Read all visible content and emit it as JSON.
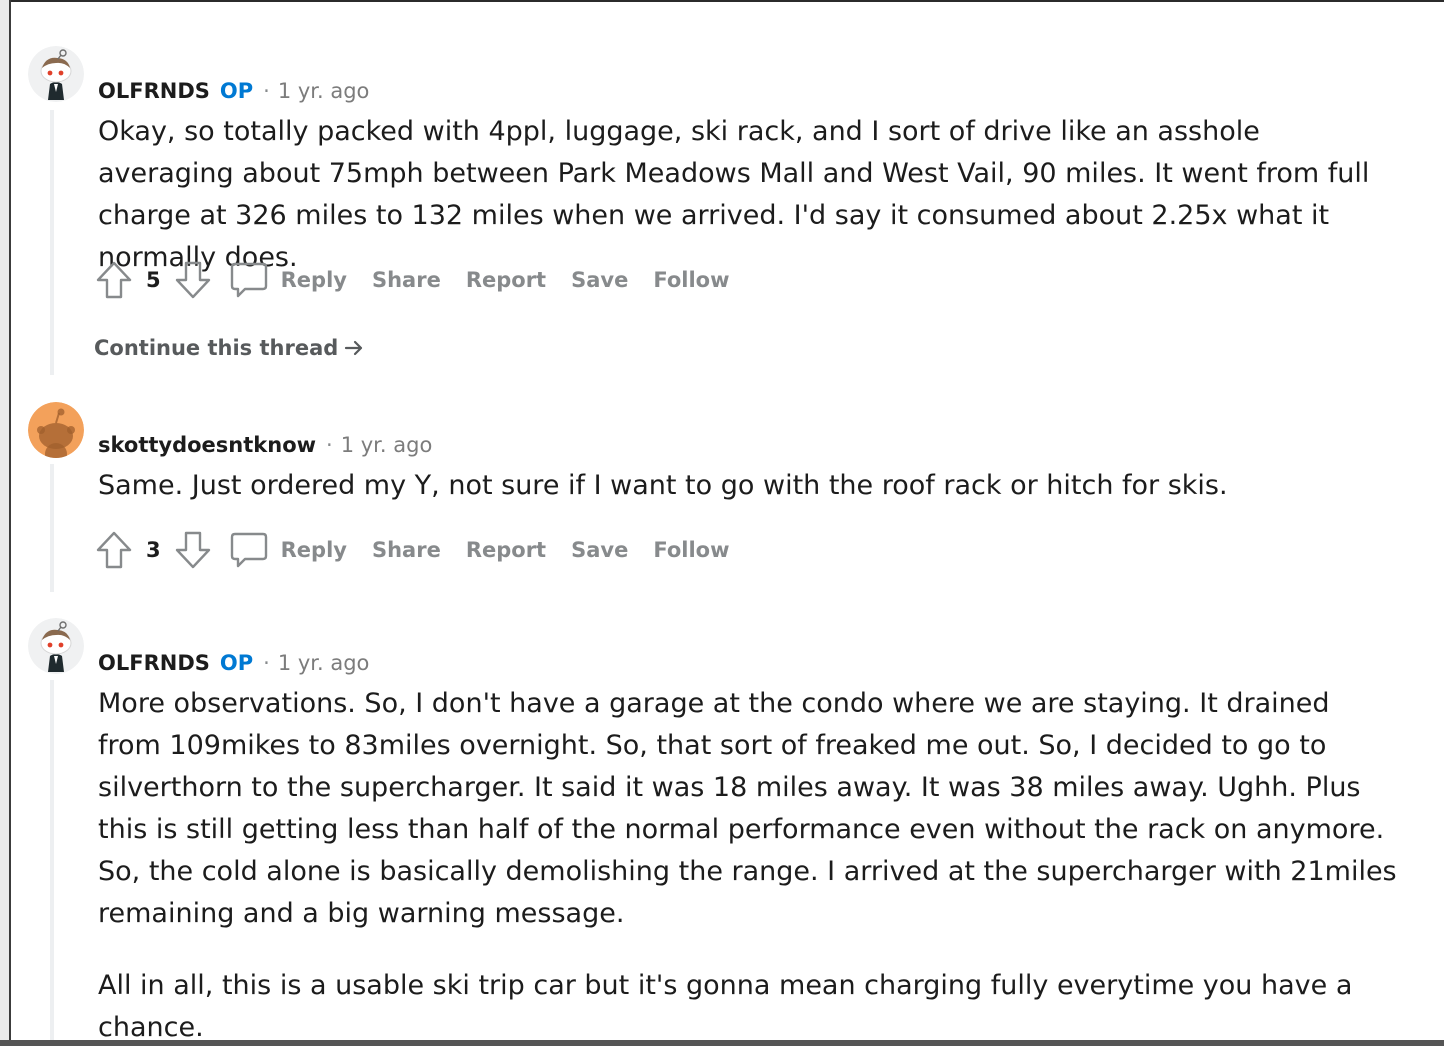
{
  "comments": [
    {
      "author": "OLFRNDS",
      "badge": "OP",
      "separator": "·",
      "time": "1 yr. ago",
      "avatar_icon": "snoo-avatar-costume-icon",
      "paragraphs": [
        "Okay, so totally packed with 4ppl, luggage, ski rack, and I sort of drive like an asshole averaging about 75mph between Park Meadows Mall and West Vail, 90 miles. It went from full charge at 326 miles to 132 miles when we arrived. I'd say it consumed about 2.25x what it normally does."
      ],
      "score": "5",
      "actions": {
        "reply": "Reply",
        "share": "Share",
        "report": "Report",
        "save": "Save",
        "follow": "Follow"
      },
      "continue_label": "Continue this thread"
    },
    {
      "author": "skottydoesntknow",
      "separator": "·",
      "time": "1 yr. ago",
      "avatar_icon": "snoo-avatar-default-icon",
      "paragraphs": [
        "Same. Just ordered my Y, not sure if I want to go with the roof rack or hitch for skis."
      ],
      "score": "3",
      "actions": {
        "reply": "Reply",
        "share": "Share",
        "report": "Report",
        "save": "Save",
        "follow": "Follow"
      }
    },
    {
      "author": "OLFRNDS",
      "badge": "OP",
      "separator": "·",
      "time": "1 yr. ago",
      "avatar_icon": "snoo-avatar-costume-icon",
      "paragraphs": [
        "More observations. So, I don't have a garage at the condo where we are staying. It drained from 109mikes to 83miles overnight. So, that sort of freaked me out. So, I decided to go to silverthorn to the supercharger. It said it was 18 miles away. It was 38 miles away. Ughh. Plus this is still getting less than half of the normal performance even without the rack on anymore. So, the cold alone is basically demolishing the range. I arrived at the supercharger with 21miles remaining and a big warning message.",
        "All in all, this is a usable ski trip car but it's gonna mean charging fully everytime you have a chance."
      ]
    }
  ],
  "colors": {
    "op_badge": "#0079d3",
    "action_text": "#878a8c",
    "default_avatar": "#f3a15b"
  }
}
